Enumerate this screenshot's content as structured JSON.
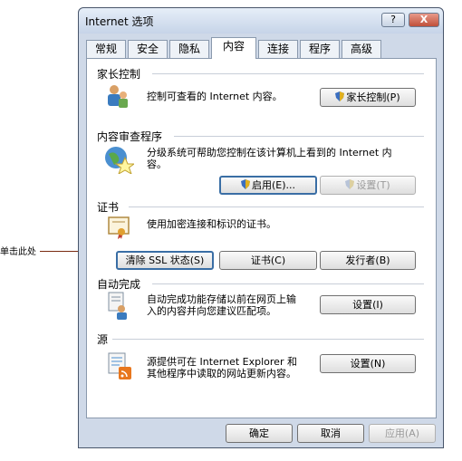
{
  "callout": {
    "label": "单击此处"
  },
  "window": {
    "title": "Internet 选项",
    "help_label": "?",
    "close_label": "X"
  },
  "tabs": [
    {
      "label": "常规"
    },
    {
      "label": "安全"
    },
    {
      "label": "隐私"
    },
    {
      "label": "内容"
    },
    {
      "label": "连接"
    },
    {
      "label": "程序"
    },
    {
      "label": "高级"
    }
  ],
  "active_tab": "内容",
  "sections": {
    "parental": {
      "title": "家长控制",
      "desc": "控制可查看的 Internet 内容。",
      "button": "家长控制(P)",
      "icon": "parental-control-icon"
    },
    "advisor": {
      "title": "内容审查程序",
      "desc_line1": "分级系统可帮助您控制在该计算机上看到的 Internet 内",
      "desc_line2": "容。",
      "enable_button": "启用(E)...",
      "settings_button": "设置(T)",
      "icon": "content-advisor-icon"
    },
    "certificates": {
      "title": "证书",
      "desc": "使用加密连接和标识的证书。",
      "clear_ssl_button": "清除 SSL 状态(S)",
      "certificates_button": "证书(C)",
      "publishers_button": "发行者(B)",
      "icon": "certificate-icon"
    },
    "autocomplete": {
      "title": "自动完成",
      "desc_line1": "自动完成功能存储以前在网页上输",
      "desc_line2": "入的内容并向您建议匹配项。",
      "settings_button": "设置(I)",
      "icon": "autocomplete-icon"
    },
    "feeds": {
      "title": "源",
      "desc_line1": "源提供可在 Internet Explorer 和",
      "desc_line2": "其他程序中读取的网站更新内容。",
      "settings_button": "设置(N)",
      "icon": "feeds-icon"
    }
  },
  "footer": {
    "ok": "确定",
    "cancel": "取消",
    "apply": "应用(A)"
  },
  "colors": {
    "window_frame": "#cfd9e8",
    "focus_border": "#3a6ea5",
    "callout_line": "#7a2a10"
  }
}
